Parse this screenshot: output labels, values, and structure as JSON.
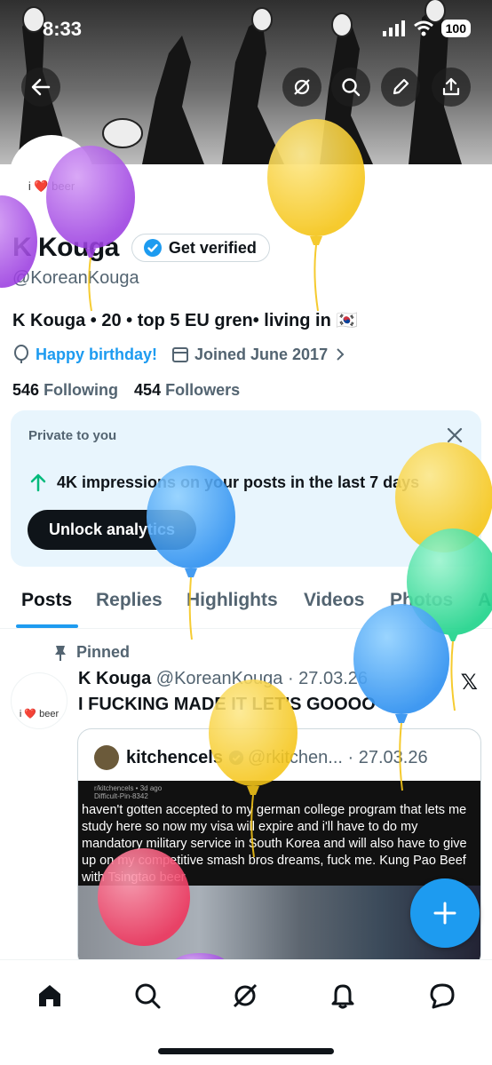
{
  "status_bar": {
    "time": "8:33",
    "battery": "100"
  },
  "profile": {
    "avatar_text": "i ❤️ beer",
    "name": "K Kouga",
    "verify_label": "Get verified",
    "handle": "@KoreanKouga",
    "bio": "K Kouga • 20 • top 5 EU gren• living in 🇰🇷",
    "birthday": "Happy birthday!",
    "joined": "Joined June 2017",
    "following_count": "546",
    "following_label": "Following",
    "followers_count": "454",
    "followers_label": "Followers"
  },
  "analytics_card": {
    "title": "Private to you",
    "stat": "4K impressions on your posts in the last 7 days",
    "button": "Unlock analytics"
  },
  "tabs": [
    {
      "label": "Posts"
    },
    {
      "label": "Replies"
    },
    {
      "label": "Highlights"
    },
    {
      "label": "Videos"
    },
    {
      "label": "Photos"
    },
    {
      "label": "A"
    }
  ],
  "pinned_post": {
    "pinned_label": "Pinned",
    "author": "K Kouga",
    "handle_date": "@KoreanKouga · 27.03.26",
    "text": "I FUCKING MADE IT LET'S GOOOO",
    "avatar_text": "i ❤️ beer",
    "quote": {
      "author": "kitchencels",
      "handle_date": "@rkitchen... · 27.03.26",
      "meta_line1": "r/kitchencels • 3d ago",
      "meta_line2": "Difficult-Pin-8342",
      "text": "haven't gotten accepted to my german college program that lets me study here so now my visa will expire and i'll have to do my mandatory military service in South Korea and will also have to give up on my competitive smash bros dreams, fuck me. Kung Pao Beef with Tsingtao beer"
    }
  },
  "colors": {
    "accent": "#1d9bf0",
    "text": "#0f1419",
    "muted": "#536471"
  },
  "icons": [
    "back-arrow-icon",
    "grok-icon",
    "search-icon",
    "edit-icon",
    "share-icon",
    "verified-badge-icon",
    "balloon-icon",
    "calendar-icon",
    "close-icon",
    "trend-up-icon",
    "pin-icon",
    "x-logo-icon",
    "plus-icon",
    "home-icon",
    "notifications-icon",
    "messages-icon"
  ]
}
